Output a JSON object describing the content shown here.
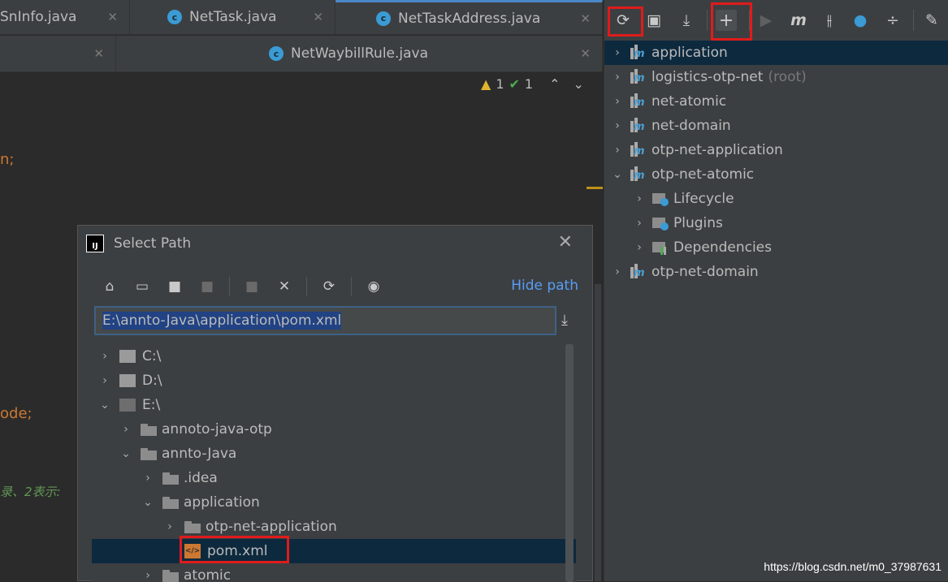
{
  "editor": {
    "tabs_row1": [
      {
        "label": "SnInfo.java"
      },
      {
        "label": "NetTask.java"
      },
      {
        "label": "NetTaskAddress.java"
      }
    ],
    "tabs_row2": [
      {
        "label": "NetWaybillRule.java"
      }
    ],
    "close_glyph": "✕",
    "class_icon_letter": "c",
    "inspections": {
      "warnings": "1",
      "weak_warnings": "1"
    },
    "code_fragments": {
      "line1": "n;",
      "line2": "ode;",
      "comment": "录、2表示:"
    }
  },
  "dialog": {
    "title": "Select Path",
    "hide_path": "Hide path",
    "path_value": "E:\\annto-Java\\application\\pom.xml",
    "toolbar_icons": [
      "home-icon",
      "desktop-icon",
      "project-folder-icon",
      "module-folder-icon",
      "new-folder-icon",
      "delete-icon",
      "refresh-icon",
      "show-hidden-icon"
    ],
    "tree": [
      {
        "label": "C:\\",
        "expanded": false,
        "kind": "drive"
      },
      {
        "label": "D:\\",
        "expanded": false,
        "kind": "drive"
      },
      {
        "label": "E:\\",
        "expanded": true,
        "kind": "drive"
      },
      {
        "label": "annoto-java-otp",
        "expanded": false,
        "kind": "folder"
      },
      {
        "label": "annto-Java",
        "expanded": true,
        "kind": "folder"
      },
      {
        "label": ".idea",
        "expanded": false,
        "kind": "folder"
      },
      {
        "label": "application",
        "expanded": true,
        "kind": "folder"
      },
      {
        "label": "otp-net-application",
        "expanded": false,
        "kind": "folder"
      },
      {
        "label": "pom.xml",
        "kind": "file",
        "selected": true
      },
      {
        "label": "atomic",
        "expanded": false,
        "kind": "folder"
      }
    ]
  },
  "maven": {
    "toolbar_icons": [
      "reload-icon",
      "generate-sources-icon",
      "download-icon",
      "add-icon",
      "run-icon",
      "maven-goal-icon",
      "toggle-offline-icon",
      "skip-tests-icon",
      "collapse-icon",
      "settings-icon"
    ],
    "projects": [
      {
        "label": "application",
        "selected": true,
        "expanded": false
      },
      {
        "label": "logistics-otp-net",
        "suffix": "(root)",
        "expanded": false
      },
      {
        "label": "net-atomic",
        "expanded": false
      },
      {
        "label": "net-domain",
        "expanded": false
      },
      {
        "label": "otp-net-application",
        "expanded": false
      },
      {
        "label": "otp-net-atomic",
        "expanded": true
      },
      {
        "label": "Lifecycle",
        "child": true,
        "kind": "lifecycle"
      },
      {
        "label": "Plugins",
        "child": true,
        "kind": "plugins"
      },
      {
        "label": "Dependencies",
        "child": true,
        "kind": "dependencies"
      },
      {
        "label": "otp-net-domain",
        "expanded": false
      }
    ]
  },
  "watermark": "https://blog.csdn.net/m0_37987631",
  "colors": {
    "highlight": "#e01b1b",
    "accent": "#589df6",
    "selection": "#0d293e"
  }
}
